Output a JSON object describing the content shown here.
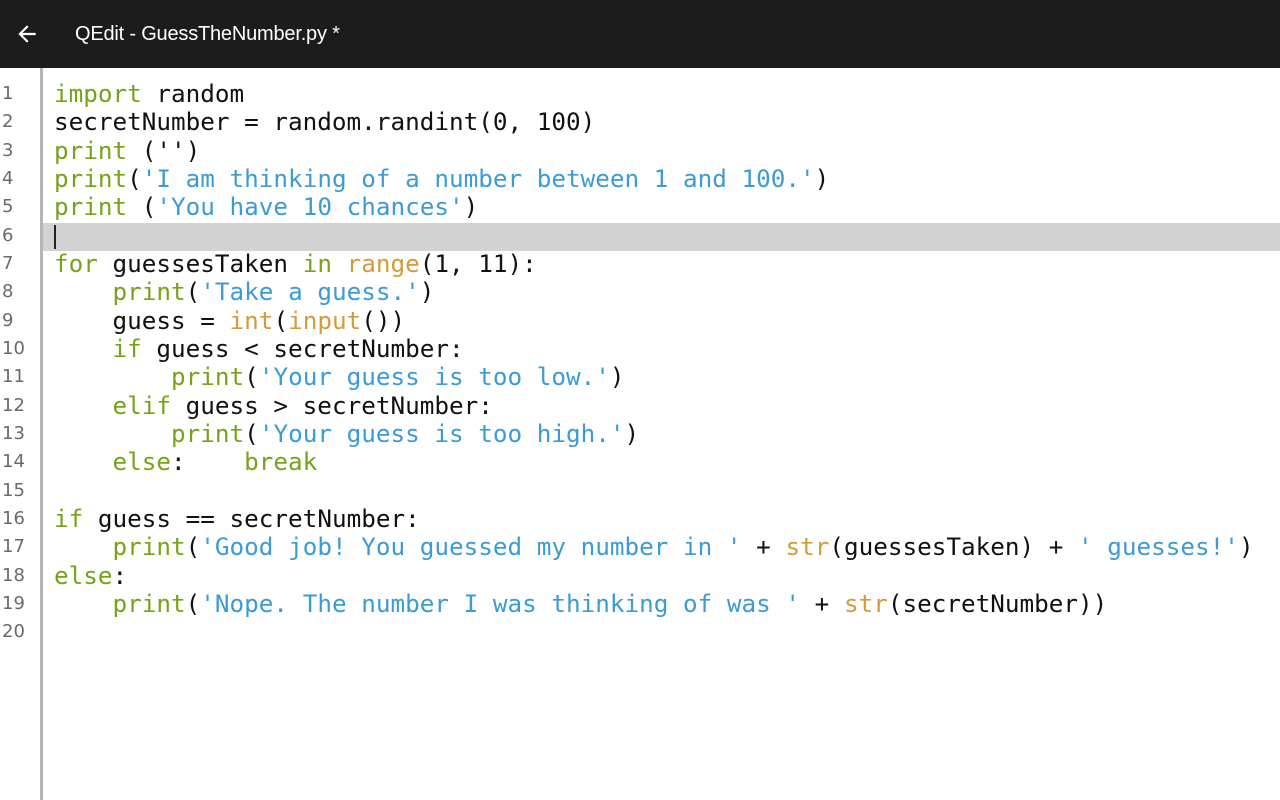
{
  "window": {
    "title": "QEdit - GuessTheNumber.py *",
    "back_icon": "back-arrow-icon"
  },
  "colors": {
    "keyword": "#78a21a",
    "string": "#3b9bd6",
    "builtin": "#d79a3a",
    "text": "#111111",
    "topbar": "#1c1c1c",
    "current_line": "#d3d3d3"
  },
  "editor": {
    "current_line": 6,
    "lines": [
      {
        "n": "1",
        "tokens": [
          {
            "t": "import",
            "k": "kw"
          },
          {
            "t": " random",
            "k": "tx"
          }
        ]
      },
      {
        "n": "2",
        "tokens": [
          {
            "t": "secretNumber = random.randint(0, 100)",
            "k": "tx"
          }
        ]
      },
      {
        "n": "3",
        "tokens": [
          {
            "t": "print",
            "k": "kw"
          },
          {
            "t": " ('')",
            "k": "tx"
          }
        ]
      },
      {
        "n": "4",
        "tokens": [
          {
            "t": "print",
            "k": "kw"
          },
          {
            "t": "(",
            "k": "tx"
          },
          {
            "t": "'I am thinking of a number between 1 and 100.'",
            "k": "st"
          },
          {
            "t": ")",
            "k": "tx"
          }
        ]
      },
      {
        "n": "5",
        "tokens": [
          {
            "t": "print",
            "k": "kw"
          },
          {
            "t": " (",
            "k": "tx"
          },
          {
            "t": "'You have 10 chances'",
            "k": "st"
          },
          {
            "t": ")",
            "k": "tx"
          }
        ]
      },
      {
        "n": "6",
        "tokens": []
      },
      {
        "n": "7",
        "tokens": [
          {
            "t": "for",
            "k": "kw"
          },
          {
            "t": " guessesTaken ",
            "k": "tx"
          },
          {
            "t": "in",
            "k": "kw"
          },
          {
            "t": " ",
            "k": "tx"
          },
          {
            "t": "range",
            "k": "bi"
          },
          {
            "t": "(1, 11):",
            "k": "tx"
          }
        ]
      },
      {
        "n": "8",
        "tokens": [
          {
            "t": "    ",
            "k": "tx"
          },
          {
            "t": "print",
            "k": "kw"
          },
          {
            "t": "(",
            "k": "tx"
          },
          {
            "t": "'Take a guess.'",
            "k": "st"
          },
          {
            "t": ")",
            "k": "tx"
          }
        ]
      },
      {
        "n": "9",
        "tokens": [
          {
            "t": "    guess = ",
            "k": "tx"
          },
          {
            "t": "int",
            "k": "bi"
          },
          {
            "t": "(",
            "k": "tx"
          },
          {
            "t": "input",
            "k": "bi"
          },
          {
            "t": "())",
            "k": "tx"
          }
        ]
      },
      {
        "n": "10",
        "tokens": [
          {
            "t": "    ",
            "k": "tx"
          },
          {
            "t": "if",
            "k": "kw"
          },
          {
            "t": " guess < secretNumber:",
            "k": "tx"
          }
        ]
      },
      {
        "n": "11",
        "tokens": [
          {
            "t": "        ",
            "k": "tx"
          },
          {
            "t": "print",
            "k": "kw"
          },
          {
            "t": "(",
            "k": "tx"
          },
          {
            "t": "'Your guess is too low.'",
            "k": "st"
          },
          {
            "t": ")",
            "k": "tx"
          }
        ]
      },
      {
        "n": "12",
        "tokens": [
          {
            "t": "    ",
            "k": "tx"
          },
          {
            "t": "elif",
            "k": "kw"
          },
          {
            "t": " guess > secretNumber:",
            "k": "tx"
          }
        ]
      },
      {
        "n": "13",
        "tokens": [
          {
            "t": "        ",
            "k": "tx"
          },
          {
            "t": "print",
            "k": "kw"
          },
          {
            "t": "(",
            "k": "tx"
          },
          {
            "t": "'Your guess is too high.'",
            "k": "st"
          },
          {
            "t": ")",
            "k": "tx"
          }
        ]
      },
      {
        "n": "14",
        "tokens": [
          {
            "t": "    ",
            "k": "tx"
          },
          {
            "t": "else",
            "k": "kw"
          },
          {
            "t": ":    ",
            "k": "tx"
          },
          {
            "t": "break",
            "k": "kw"
          }
        ]
      },
      {
        "n": "15",
        "tokens": []
      },
      {
        "n": "16",
        "tokens": [
          {
            "t": "if",
            "k": "kw"
          },
          {
            "t": " guess == secretNumber:",
            "k": "tx"
          }
        ]
      },
      {
        "n": "17",
        "tokens": [
          {
            "t": "    ",
            "k": "tx"
          },
          {
            "t": "print",
            "k": "kw"
          },
          {
            "t": "(",
            "k": "tx"
          },
          {
            "t": "'Good job! You guessed my number in '",
            "k": "st"
          },
          {
            "t": " + ",
            "k": "tx"
          },
          {
            "t": "str",
            "k": "bi"
          },
          {
            "t": "(guessesTaken) + ",
            "k": "tx"
          },
          {
            "t": "' guesses!'",
            "k": "st"
          },
          {
            "t": ")",
            "k": "tx"
          }
        ]
      },
      {
        "n": "18",
        "tokens": [
          {
            "t": "else",
            "k": "kw"
          },
          {
            "t": ":",
            "k": "tx"
          }
        ]
      },
      {
        "n": "19",
        "tokens": [
          {
            "t": "    ",
            "k": "tx"
          },
          {
            "t": "print",
            "k": "kw"
          },
          {
            "t": "(",
            "k": "tx"
          },
          {
            "t": "'Nope. The number I was thinking of was '",
            "k": "st"
          },
          {
            "t": " + ",
            "k": "tx"
          },
          {
            "t": "str",
            "k": "bi"
          },
          {
            "t": "(secretNumber))",
            "k": "tx"
          }
        ]
      },
      {
        "n": "20",
        "tokens": []
      }
    ]
  }
}
